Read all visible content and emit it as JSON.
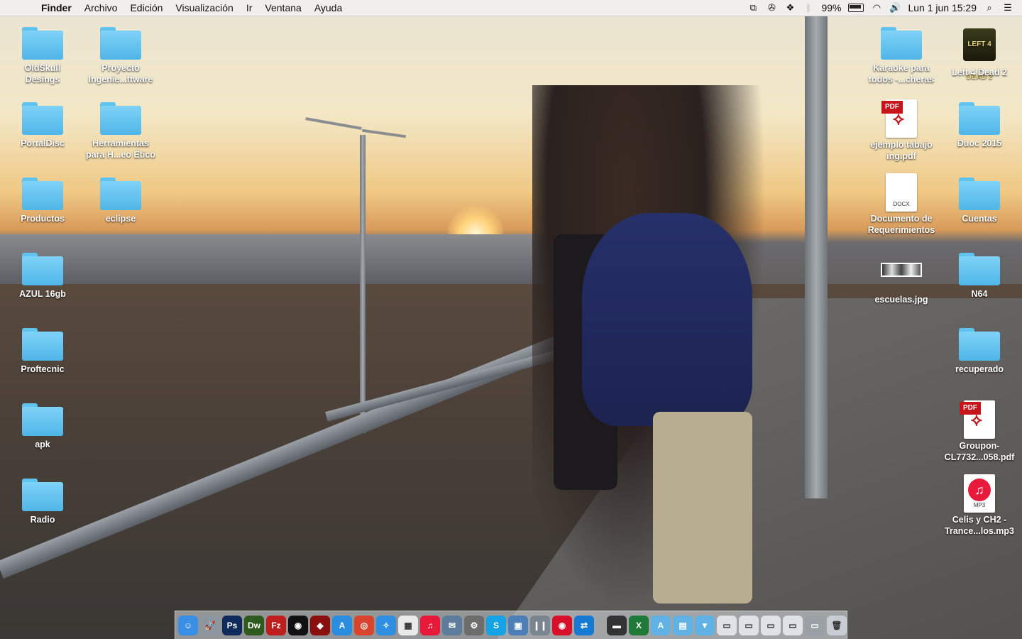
{
  "menubar": {
    "apple_icon": "apple-icon",
    "app_name": "Finder",
    "menus": [
      "Archivo",
      "Edición",
      "Visualización",
      "Ir",
      "Ventana",
      "Ayuda"
    ],
    "battery_percent": "99%",
    "datetime": "Lun 1 jun  15:29"
  },
  "desktop": {
    "left_column_1": [
      {
        "label": "OldSkull\nDesings"
      },
      {
        "label": "PortalDisc"
      },
      {
        "label": "Productos"
      },
      {
        "label": "AZUL 16gb"
      },
      {
        "label": "Proftecnic"
      },
      {
        "label": "apk"
      },
      {
        "label": "Radio"
      }
    ],
    "left_column_2": [
      {
        "label": "Proyecto\nIngenie...ftware"
      },
      {
        "label": "Herramientas\npara H...eo Ético"
      },
      {
        "label": "eclipse"
      }
    ],
    "right_column_1": [
      {
        "label": "Karaoke para\ntodos -...cheras",
        "kind": "folder"
      },
      {
        "label": "ejemplo tabajo\ning.pdf",
        "kind": "pdf",
        "tag": "PDF"
      },
      {
        "label": "Documento de\nRequerimientos",
        "kind": "docx",
        "tag": "DOCX"
      },
      {
        "label": "escuelas.jpg",
        "kind": "jpg"
      }
    ],
    "right_column_2": [
      {
        "label": "Left 4 Dead 2",
        "kind": "game",
        "art_text": "LEFT 4 DEAD 2"
      },
      {
        "label": "Duoc 2015",
        "kind": "folder"
      },
      {
        "label": "Cuentas",
        "kind": "folder"
      },
      {
        "label": "N64",
        "kind": "folder"
      },
      {
        "label": "recuperado",
        "kind": "folder"
      },
      {
        "label": "Groupon-\nCL7732...058.pdf",
        "kind": "pdf",
        "tag": "PDF"
      },
      {
        "label": "Celis y CH2 -\nTrance...los.mp3",
        "kind": "mp3",
        "tag": "MP3"
      }
    ]
  },
  "dock": {
    "apps": [
      {
        "name": "finder",
        "glyph": "☺",
        "color": "#3a8ee6"
      },
      {
        "name": "launchpad",
        "glyph": "🚀",
        "color": "#8d969e"
      },
      {
        "name": "photoshop",
        "glyph": "Ps",
        "color": "#0f2a5c"
      },
      {
        "name": "dreamweaver",
        "glyph": "Dw",
        "color": "#2f5a1e"
      },
      {
        "name": "filezilla",
        "glyph": "Fz",
        "color": "#bf1e1e"
      },
      {
        "name": "audio-app",
        "glyph": "◉",
        "color": "#111111"
      },
      {
        "name": "red-app",
        "glyph": "◆",
        "color": "#8a1010"
      },
      {
        "name": "app-store",
        "glyph": "A",
        "color": "#2b8de0"
      },
      {
        "name": "chrome",
        "glyph": "◎",
        "color": "#d9442e"
      },
      {
        "name": "safari",
        "glyph": "✧",
        "color": "#2f8fe2"
      },
      {
        "name": "grid-app",
        "glyph": "▦",
        "color": "#eaeaea"
      },
      {
        "name": "itunes",
        "glyph": "♫",
        "color": "#e8193a"
      },
      {
        "name": "mail-app",
        "glyph": "✉",
        "color": "#5e7d9c"
      },
      {
        "name": "system-preferences",
        "glyph": "⚙",
        "color": "#6d6d6d"
      },
      {
        "name": "skype",
        "glyph": "S",
        "color": "#14a3e5"
      },
      {
        "name": "utility-app",
        "glyph": "▣",
        "color": "#4c7fb8"
      },
      {
        "name": "pause-app",
        "glyph": "❙❙",
        "color": "#7a8590"
      },
      {
        "name": "music-app-red",
        "glyph": "◉",
        "color": "#d8102a"
      },
      {
        "name": "teamviewer",
        "glyph": "⇄",
        "color": "#1679d4"
      }
    ],
    "stacks": [
      {
        "name": "terminal-stack",
        "glyph": "▬",
        "color": "#333333"
      },
      {
        "name": "excel-stack",
        "glyph": "X",
        "color": "#1f7a3a"
      },
      {
        "name": "applications-folder",
        "glyph": "A",
        "color": "#5fb1e6"
      },
      {
        "name": "documents-folder",
        "glyph": "▤",
        "color": "#5fb1e6"
      },
      {
        "name": "downloads-folder",
        "glyph": "▼",
        "color": "#5fb1e6"
      },
      {
        "name": "stack-1",
        "glyph": "▭",
        "color": "#dfe3e7"
      },
      {
        "name": "stack-2",
        "glyph": "▭",
        "color": "#dfe3e7"
      },
      {
        "name": "stack-3",
        "glyph": "▭",
        "color": "#dfe3e7"
      },
      {
        "name": "stack-4",
        "glyph": "▭",
        "color": "#dfe3e7"
      },
      {
        "name": "stack-5",
        "glyph": "▭",
        "color": "#9aa0a6"
      },
      {
        "name": "trash",
        "glyph": "🗑",
        "color": "#c7cdd2"
      }
    ]
  }
}
